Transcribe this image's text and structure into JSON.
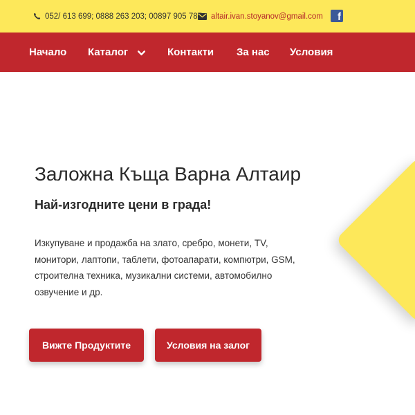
{
  "topbar": {
    "phone_icon": "phone-icon",
    "phones": "052/ 613 699; 0888 263 203; 00897 905 787",
    "mail_icon": "envelope-icon",
    "email": "altair.ivan.stoyanov@gmail.com",
    "social_icon": "facebook-icon",
    "facebook_glyph": "f"
  },
  "nav": {
    "items": [
      {
        "label": "Начало"
      },
      {
        "label": "Каталог",
        "has_dropdown": true
      },
      {
        "label": "Контакти"
      },
      {
        "label": "За нас"
      },
      {
        "label": "Условия"
      }
    ]
  },
  "hero": {
    "title": "Заложна Къща Варна Алтаир",
    "subtitle": "Най-изгодните цени в града!",
    "description": "Изкупуване и продажба на злато, сребро, монети, TV, монитори, лаптопи, таблети, фотоапарати, компютри, GSM, строителна техника, музикални системи, автомобилно озвучение и др.",
    "buttons": {
      "products": "Вижте Продуктите",
      "terms": "Условия на залог"
    }
  },
  "colors": {
    "accent_red": "#c0272d",
    "accent_yellow": "#fde85a",
    "facebook_blue": "#3b5998"
  }
}
